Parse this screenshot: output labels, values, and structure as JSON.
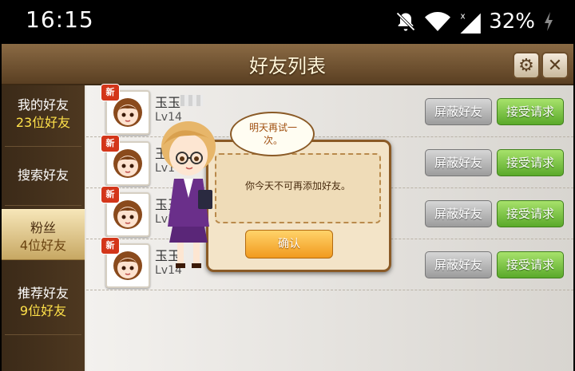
{
  "status_bar": {
    "time": "16:15",
    "battery": "32%",
    "icons": [
      "notifications-off-icon",
      "wifi-icon",
      "signal-icon",
      "battery-charging-icon"
    ]
  },
  "window": {
    "title": "好友列表",
    "settings_icon": "gear-icon",
    "close_icon": "close-icon"
  },
  "sidebar": {
    "items": [
      {
        "label": "我的好友",
        "count": "23位好友"
      },
      {
        "label": "搜索好友",
        "count": ""
      },
      {
        "label": "粉丝",
        "count": "4位好友"
      },
      {
        "label": "推荐好友",
        "count": "9位好友"
      }
    ],
    "active_index": 2
  },
  "friend_requests": [
    {
      "badge": "新",
      "name": "玉玉",
      "level": "Lv14",
      "block_label": "屏蔽好友",
      "accept_label": "接受请求"
    },
    {
      "badge": "新",
      "name": "玉",
      "level": "Lv14",
      "block_label": "屏蔽好友",
      "accept_label": "接受请求"
    },
    {
      "badge": "新",
      "name": "玉玉",
      "level": "Lv14",
      "block_label": "屏蔽好友",
      "accept_label": "接受请求"
    },
    {
      "badge": "新",
      "name": "玉玉",
      "level": "Lv14",
      "block_label": "屏蔽好友",
      "accept_label": "接受请求"
    }
  ],
  "dialog": {
    "bubble_text": "明天再试一次。",
    "message": "你今天不可再添加好友。",
    "confirm_label": "确认"
  },
  "colors": {
    "title_bar": "#6e5232",
    "accept_button": "#6fbf33",
    "block_button": "#b5b5b5",
    "confirm_button": "#f4a62a"
  }
}
